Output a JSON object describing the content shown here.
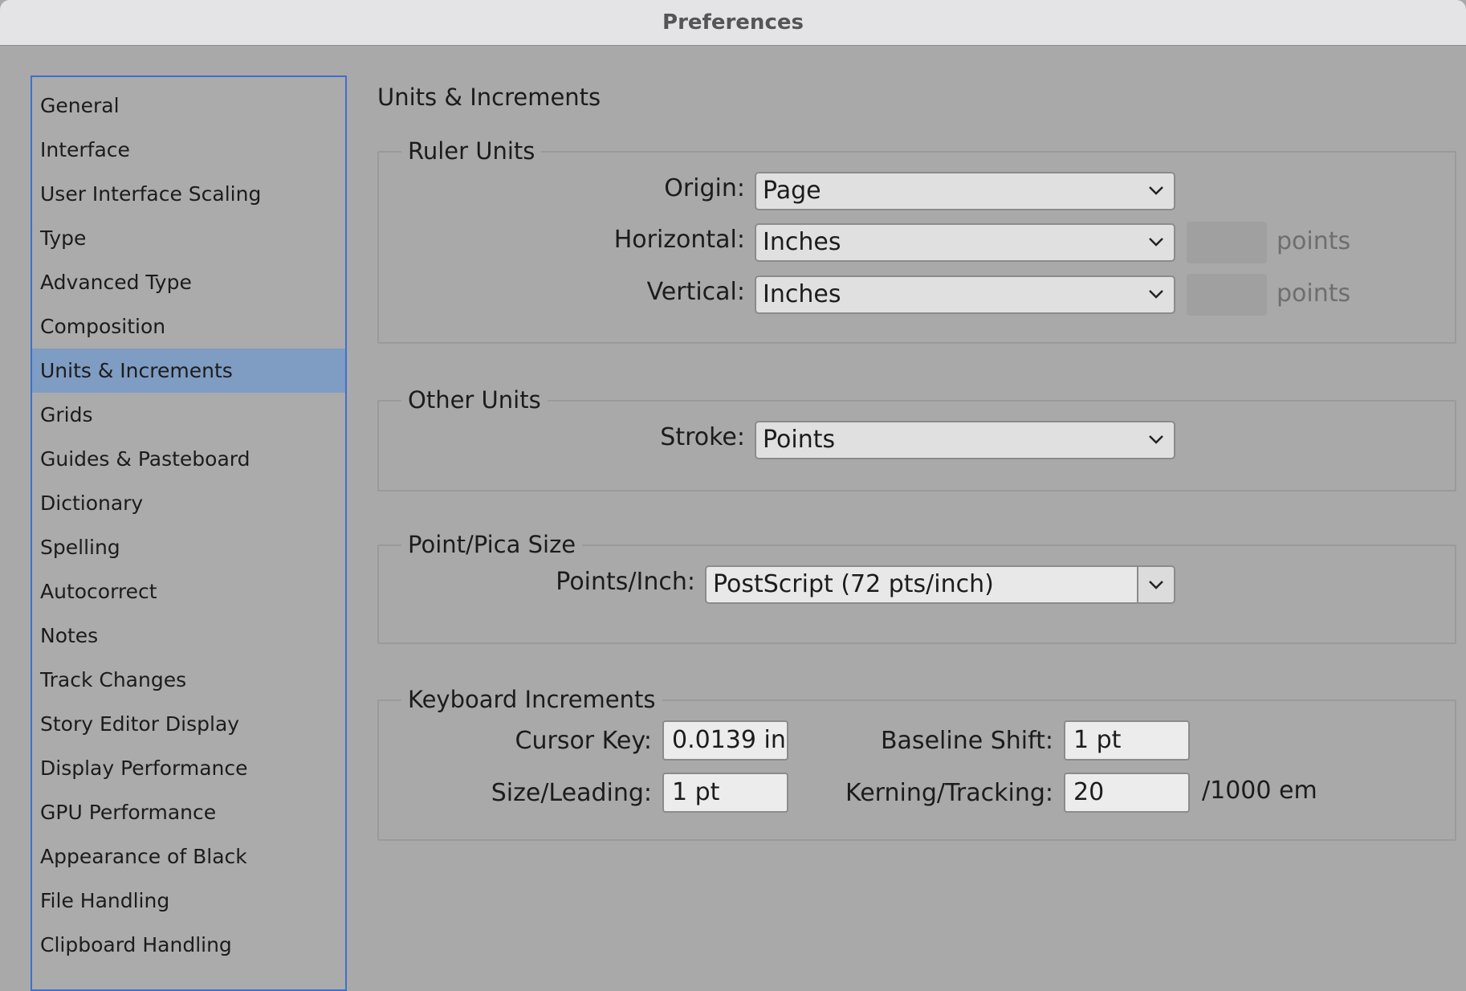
{
  "window": {
    "title": "Preferences"
  },
  "sidebar": {
    "items": [
      {
        "label": "General"
      },
      {
        "label": "Interface"
      },
      {
        "label": "User Interface Scaling"
      },
      {
        "label": "Type"
      },
      {
        "label": "Advanced Type"
      },
      {
        "label": "Composition"
      },
      {
        "label": "Units & Increments",
        "selected": true
      },
      {
        "label": "Grids"
      },
      {
        "label": "Guides & Pasteboard"
      },
      {
        "label": "Dictionary"
      },
      {
        "label": "Spelling"
      },
      {
        "label": "Autocorrect"
      },
      {
        "label": "Notes"
      },
      {
        "label": "Track Changes"
      },
      {
        "label": "Story Editor Display"
      },
      {
        "label": "Display Performance"
      },
      {
        "label": "GPU Performance"
      },
      {
        "label": "Appearance of Black"
      },
      {
        "label": "File Handling"
      },
      {
        "label": "Clipboard Handling"
      }
    ],
    "selected_color": "#7f9cc3",
    "border_color": "#3f6fcc"
  },
  "main": {
    "title": "Units & Increments",
    "ruler_units": {
      "title": "Ruler Units",
      "origin": {
        "label": "Origin:",
        "value": "Page"
      },
      "horizontal": {
        "label": "Horizontal:",
        "value": "Inches",
        "unit": "points"
      },
      "vertical": {
        "label": "Vertical:",
        "value": "Inches",
        "unit": "points"
      }
    },
    "other_units": {
      "title": "Other Units",
      "stroke": {
        "label": "Stroke:",
        "value": "Points"
      }
    },
    "point_pica": {
      "title": "Point/Pica Size",
      "points_inch": {
        "label": "Points/Inch:",
        "value": "PostScript (72 pts/inch)"
      }
    },
    "keyboard": {
      "title": "Keyboard Increments",
      "cursor_key": {
        "label": "Cursor Key:",
        "value": "0.0139 in"
      },
      "size_leading": {
        "label": "Size/Leading:",
        "value": "1 pt"
      },
      "baseline_shift": {
        "label": "Baseline Shift:",
        "value": "1 pt"
      },
      "kerning_tracking": {
        "label": "Kerning/Tracking:",
        "value": "20",
        "unit": "/1000 em"
      }
    }
  },
  "icons": {
    "dropdown": "chevron-down-icon"
  }
}
